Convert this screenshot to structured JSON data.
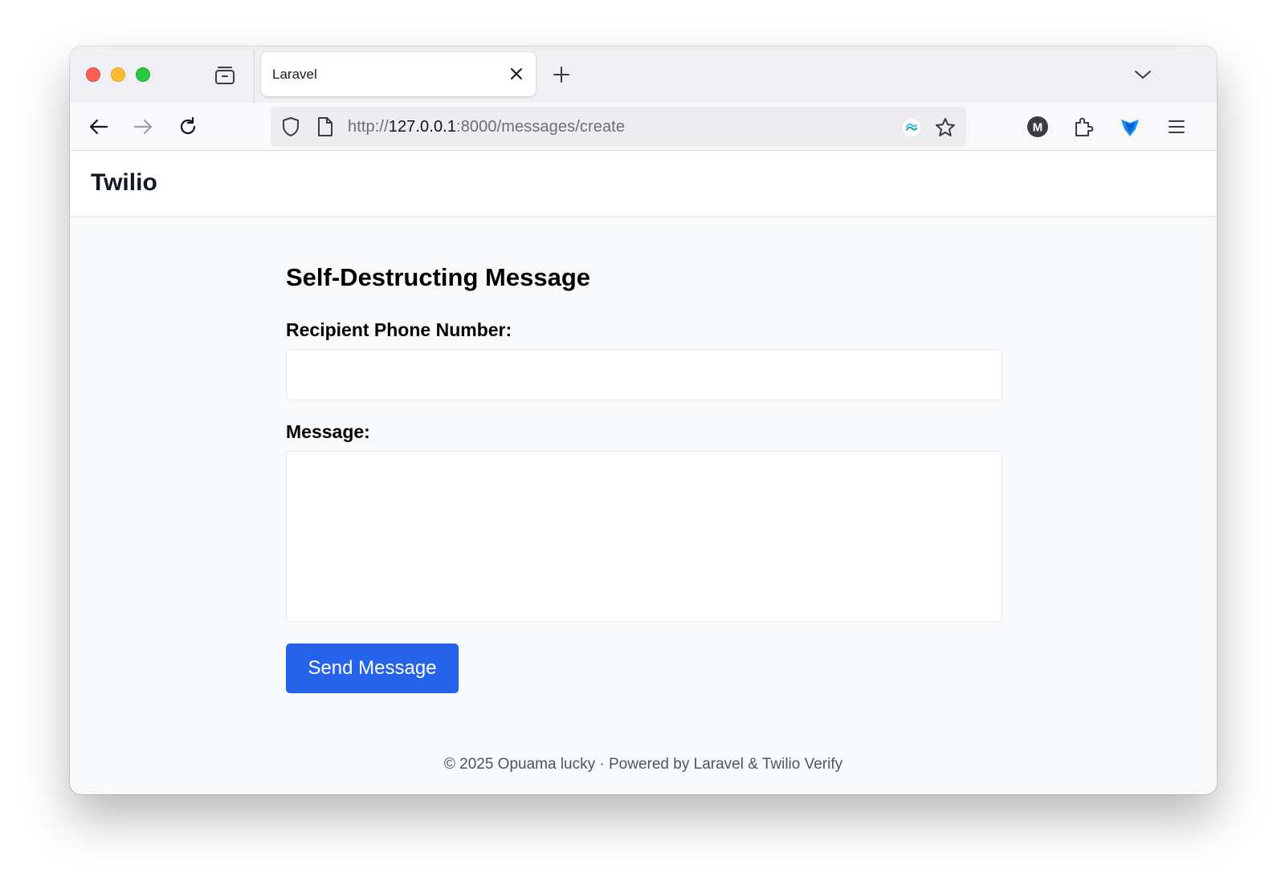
{
  "browser": {
    "tab_title": "Laravel",
    "url": {
      "scheme": "http://",
      "host": "127.0.0.1",
      "rest": ":8000/messages/create"
    },
    "account_initial": "M",
    "icons": {
      "tabs": "tab-overview-icon",
      "close": "close-icon",
      "new_tab": "plus-icon",
      "tab_list": "chevron-down-icon",
      "back": "arrow-left-icon",
      "forward": "arrow-right-icon",
      "reload": "reload-icon",
      "shield": "shield-icon",
      "page": "page-icon",
      "tailwind_ext": "tailwind-icon",
      "bookmark": "star-icon",
      "extensions": "puzzle-icon",
      "metamask": "metamask-icon",
      "menu": "hamburger-icon"
    }
  },
  "header": {
    "brand": "Twilio"
  },
  "form": {
    "title": "Self-Destructing Message",
    "phone_label": "Recipient Phone Number:",
    "phone_value": "",
    "message_label": "Message:",
    "message_value": "",
    "submit_label": "Send Message"
  },
  "footer": {
    "text": "© 2025 Opuama lucky · Powered by Laravel & Twilio Verify"
  },
  "colors": {
    "primary_button": "#2563eb",
    "page_background": "#f9fafb"
  }
}
